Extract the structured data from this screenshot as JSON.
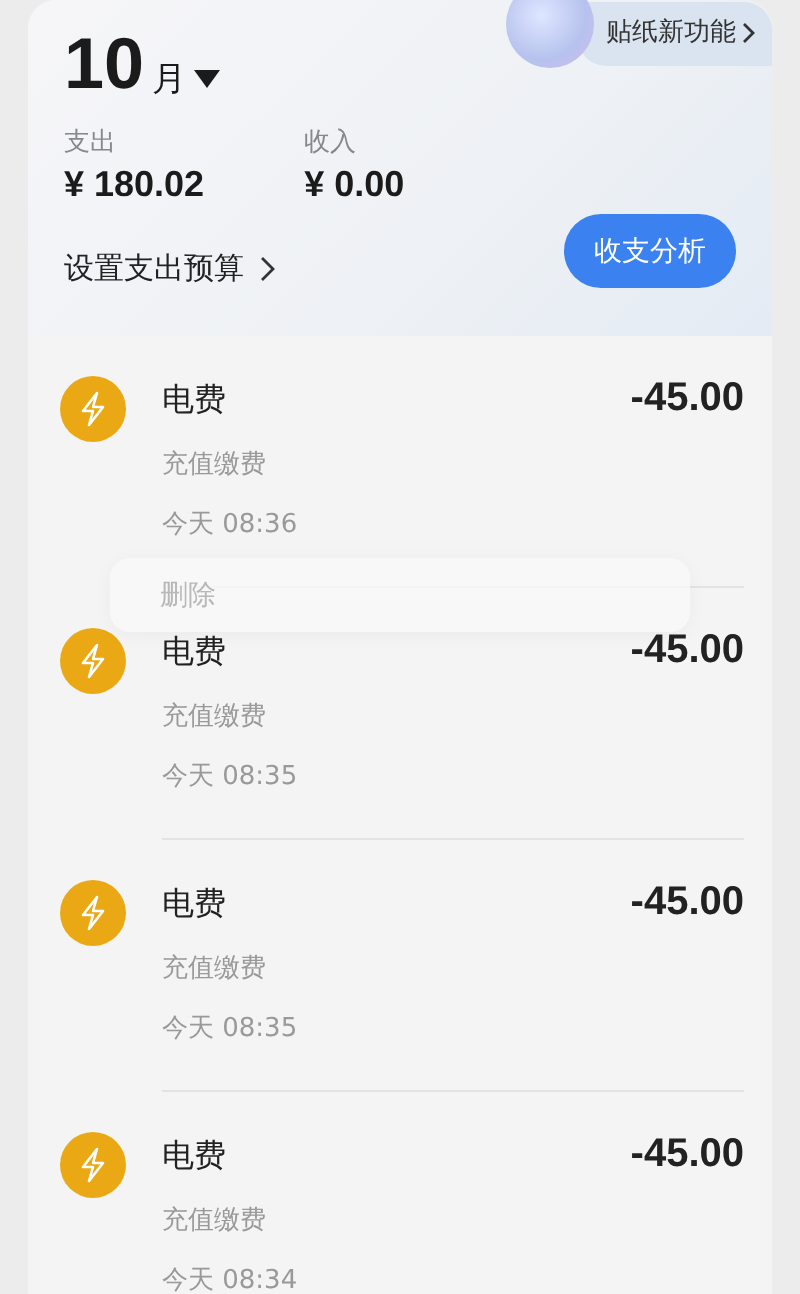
{
  "header": {
    "month": "10",
    "month_unit": "月",
    "sticker_promo": "贴纸新功能",
    "stats": [
      {
        "label": "支出",
        "value": "¥ 180.02"
      },
      {
        "label": "收入",
        "value": "¥ 0.00"
      }
    ],
    "budget_link": "设置支出预算",
    "analysis_button": "收支分析"
  },
  "transactions": [
    {
      "title": "电费",
      "category": "充值缴费",
      "time": "今天 08:36",
      "amount": "-45.00"
    },
    {
      "title": "电费",
      "category": "充值缴费",
      "time": "今天 08:35",
      "amount": "-45.00"
    },
    {
      "title": "电费",
      "category": "充值缴费",
      "time": "今天 08:35",
      "amount": "-45.00"
    },
    {
      "title": "电费",
      "category": "充值缴费",
      "time": "今天 08:34",
      "amount": "-45.00"
    }
  ],
  "context_menu": {
    "items": [
      "删除"
    ]
  }
}
